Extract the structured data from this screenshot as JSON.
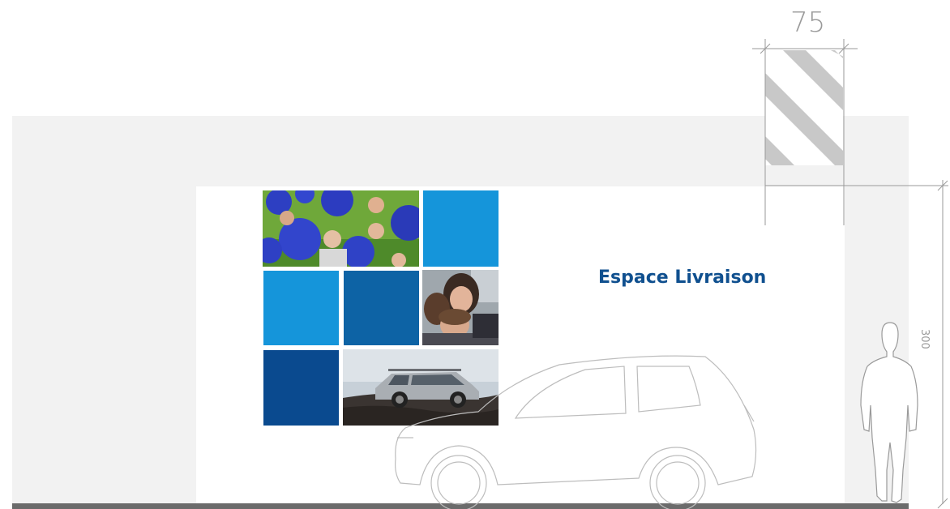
{
  "signage": {
    "title": "Espace Livraison"
  },
  "dimensions": {
    "top_width": "75",
    "right_height": "300"
  },
  "colors": {
    "brand_blue_dark": "#0a4a8f",
    "brand_blue_mid": "#0d63a5",
    "brand_blue_light": "#0f8fd6",
    "brand_blue_bright": "#1595da",
    "title_blue": "#10508f",
    "canopy_grey": "#f2f2f2",
    "floor_grey": "#6b6b6b",
    "outline_grey": "#b8b8b8"
  },
  "mosaic": {
    "tiles": [
      {
        "kind": "photo",
        "subject": "people-with-blue-balloons"
      },
      {
        "kind": "color",
        "color": "#1595da"
      },
      {
        "kind": "color",
        "color": "#1595da"
      },
      {
        "kind": "color",
        "color": "#0d63a5"
      },
      {
        "kind": "photo",
        "subject": "family-in-car"
      },
      {
        "kind": "color",
        "color": "#0a4a8f"
      },
      {
        "kind": "photo",
        "subject": "suv-on-rocks"
      }
    ]
  },
  "icons": {
    "hatch_marker": "hatch-pattern-icon",
    "car_outline": "car-outline-icon",
    "person_silhouette": "person-silhouette-icon"
  }
}
